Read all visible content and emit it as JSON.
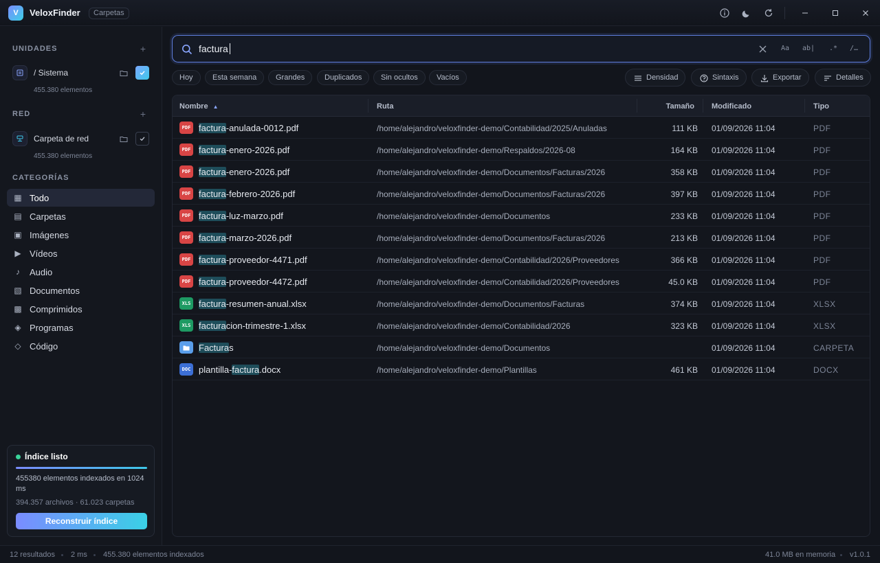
{
  "app": {
    "logo": "V",
    "name": "VeloxFinder",
    "chip": "Carpetas"
  },
  "titlebar": {
    "icons": [
      "info-icon",
      "moon-icon",
      "refresh-icon",
      "minimize-icon",
      "maximize-icon",
      "close-icon"
    ]
  },
  "sidebar": {
    "units_title": "UNIDADES",
    "system": {
      "name": "/ Sistema",
      "count": "455.380 elementos",
      "checked": true
    },
    "network_title": "RED",
    "network": {
      "name": "Carpeta de red",
      "count": "455.380 elementos",
      "checked": false
    },
    "categories_title": "CATEGORÍAS",
    "categories": [
      {
        "label": "Todo",
        "icon": "▦"
      },
      {
        "label": "Carpetas",
        "icon": "▤"
      },
      {
        "label": "Imágenes",
        "icon": "▣"
      },
      {
        "label": "Vídeos",
        "icon": "▶"
      },
      {
        "label": "Audio",
        "icon": "♪"
      },
      {
        "label": "Documentos",
        "icon": "▧"
      },
      {
        "label": "Comprimidos",
        "icon": "▩"
      },
      {
        "label": "Programas",
        "icon": "◈"
      },
      {
        "label": "Código",
        "icon": "◇"
      }
    ],
    "active_category": "Todo",
    "index": {
      "title": "Índice listo",
      "text": "455380 elementos indexados en 1024 ms",
      "sub": "394.357 archivos · 61.023 carpetas",
      "button": "Reconstruir índice"
    }
  },
  "search": {
    "value": "factura",
    "options": [
      "Aa",
      "ab|",
      ".*",
      "/…"
    ]
  },
  "filters": [
    "Hoy",
    "Esta semana",
    "Grandes",
    "Duplicados",
    "Sin ocultos",
    "Vacíos"
  ],
  "tools": [
    "Densidad",
    "Sintaxis",
    "Exportar",
    "Detalles"
  ],
  "table": {
    "headers": {
      "name": "Nombre",
      "sort_indicator": "▲",
      "path": "Ruta",
      "size": "Tamaño",
      "modified": "Modificado",
      "type": "Tipo"
    },
    "rows": [
      {
        "icon": "PDF",
        "kind": "pdf",
        "pre": "",
        "hl": "factura",
        "post": "-anulada-0012.pdf",
        "path": "/home/alejandro/veloxfinder-demo/Contabilidad/2025/Anuladas",
        "size": "111 KB",
        "modified": "01/09/2026 11:04",
        "type": "PDF"
      },
      {
        "icon": "PDF",
        "kind": "pdf",
        "pre": "",
        "hl": "factura",
        "post": "-enero-2026.pdf",
        "path": "/home/alejandro/veloxfinder-demo/Respaldos/2026-08",
        "size": "164 KB",
        "modified": "01/09/2026 11:04",
        "type": "PDF"
      },
      {
        "icon": "PDF",
        "kind": "pdf",
        "pre": "",
        "hl": "factura",
        "post": "-enero-2026.pdf",
        "path": "/home/alejandro/veloxfinder-demo/Documentos/Facturas/2026",
        "size": "358 KB",
        "modified": "01/09/2026 11:04",
        "type": "PDF"
      },
      {
        "icon": "PDF",
        "kind": "pdf",
        "pre": "",
        "hl": "factura",
        "post": "-febrero-2026.pdf",
        "path": "/home/alejandro/veloxfinder-demo/Documentos/Facturas/2026",
        "size": "397 KB",
        "modified": "01/09/2026 11:04",
        "type": "PDF"
      },
      {
        "icon": "PDF",
        "kind": "pdf",
        "pre": "",
        "hl": "factura",
        "post": "-luz-marzo.pdf",
        "path": "/home/alejandro/veloxfinder-demo/Documentos",
        "size": "233 KB",
        "modified": "01/09/2026 11:04",
        "type": "PDF"
      },
      {
        "icon": "PDF",
        "kind": "pdf",
        "pre": "",
        "hl": "factura",
        "post": "-marzo-2026.pdf",
        "path": "/home/alejandro/veloxfinder-demo/Documentos/Facturas/2026",
        "size": "213 KB",
        "modified": "01/09/2026 11:04",
        "type": "PDF"
      },
      {
        "icon": "PDF",
        "kind": "pdf",
        "pre": "",
        "hl": "factura",
        "post": "-proveedor-4471.pdf",
        "path": "/home/alejandro/veloxfinder-demo/Contabilidad/2026/Proveedores",
        "size": "366 KB",
        "modified": "01/09/2026 11:04",
        "type": "PDF"
      },
      {
        "icon": "PDF",
        "kind": "pdf",
        "pre": "",
        "hl": "factura",
        "post": "-proveedor-4472.pdf",
        "path": "/home/alejandro/veloxfinder-demo/Contabilidad/2026/Proveedores",
        "size": "45.0 KB",
        "modified": "01/09/2026 11:04",
        "type": "PDF"
      },
      {
        "icon": "XLS",
        "kind": "xls",
        "pre": "",
        "hl": "factura",
        "post": "-resumen-anual.xlsx",
        "path": "/home/alejandro/veloxfinder-demo/Documentos/Facturas",
        "size": "374 KB",
        "modified": "01/09/2026 11:04",
        "type": "XLSX"
      },
      {
        "icon": "XLS",
        "kind": "xls",
        "pre": "",
        "hl": "factura",
        "post": "cion-trimestre-1.xlsx",
        "path": "/home/alejandro/veloxfinder-demo/Contabilidad/2026",
        "size": "323 KB",
        "modified": "01/09/2026 11:04",
        "type": "XLSX"
      },
      {
        "icon": "",
        "kind": "folder",
        "pre": "",
        "hl": "Factura",
        "post": "s",
        "path": "/home/alejandro/veloxfinder-demo/Documentos",
        "size": "",
        "modified": "01/09/2026 11:04",
        "type": "CARPETA"
      },
      {
        "icon": "DOC",
        "kind": "doc",
        "pre": "plantilla-",
        "hl": "factura",
        "post": ".docx",
        "path": "/home/alejandro/veloxfinder-demo/Plantillas",
        "size": "461 KB",
        "modified": "01/09/2026 11:04",
        "type": "DOCX"
      }
    ]
  },
  "status": {
    "results": "12 resultados",
    "time": "2 ms",
    "indexed": "455.380 elementos indexados",
    "memory": "41.0 MB en memoria",
    "version": "v1.0.1"
  },
  "colors": {
    "accent_start": "#7a8cff",
    "accent_end": "#3ec8ea",
    "ready": "#3ad39a",
    "pdf": "#d84545",
    "xls": "#1e9a63",
    "doc": "#3c6fd6",
    "highlight": "#1e4d5a"
  }
}
